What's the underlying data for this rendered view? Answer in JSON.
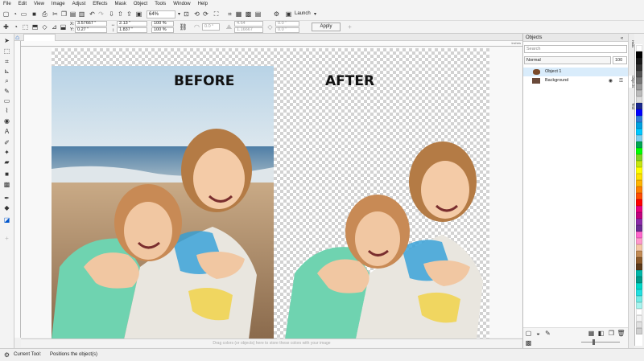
{
  "menu": [
    "File",
    "Edit",
    "View",
    "Image",
    "Adjust",
    "Effects",
    "Mask",
    "Object",
    "Tools",
    "Window",
    "Help"
  ],
  "toolbar": {
    "zoom_value": "64%",
    "launch_label": "Launch"
  },
  "property_bar": {
    "x_label": "X:",
    "x_value": "3.57667 \"",
    "y_label": "Y:",
    "y_value": "0.27 \"",
    "w_value": "2.13 \"",
    "h_value": "1.837 \"",
    "scale_w": "100 %",
    "scale_h": "100 %",
    "angle": "0.0 °",
    "skew1": "4.64",
    "skew2": "1.16667",
    "offset1": "0.0 \"",
    "offset2": "0.0 \"",
    "apply_label": "Apply"
  },
  "canvas": {
    "before_label": "BEFORE",
    "after_label": "AFTER",
    "ruler_unit": "inches",
    "hint_text": "Drag colors (or objects) here to store these colors with your image"
  },
  "objects_panel": {
    "title": "Objects",
    "search_placeholder": "Search",
    "blend_mode": "Normal",
    "opacity": "100",
    "items": [
      {
        "label": "Object 1",
        "selected": true
      },
      {
        "label": "Background",
        "selected": false
      }
    ],
    "dock_tab_hints": "Hints",
    "dock_tab_objects": "Objects",
    "dock_tab_text": "Text"
  },
  "status": {
    "current_tool_label": "Current Tool:",
    "current_tool_value": "Positions the object(s)"
  },
  "palette_colors": [
    "#ffffff",
    "#000000",
    "#1a1a1a",
    "#333333",
    "#555555",
    "#777777",
    "#999999",
    "#bbbbbb",
    "#dddddd",
    "#1b2a8c",
    "#0000ff",
    "#2e7bd6",
    "#00a0e0",
    "#00c8ff",
    "#7ed0f0",
    "#00a651",
    "#00ff00",
    "#7fd321",
    "#c5e60f",
    "#ffff00",
    "#ffe100",
    "#ffb400",
    "#ff7f00",
    "#ff4d00",
    "#ff0000",
    "#e6007e",
    "#c0007e",
    "#8b2aa8",
    "#6a2c91",
    "#ff66cc",
    "#ff99cc",
    "#f5c6a5",
    "#c28b55",
    "#8b5a2b",
    "#5a3a1a",
    "#00b7a8",
    "#009b8a",
    "#00d8c8",
    "#22e0e0",
    "#73ece6",
    "#a8f4ee",
    "#ffffff",
    "#f3f3f3",
    "#e0e0e0",
    "#cfcfcf"
  ]
}
